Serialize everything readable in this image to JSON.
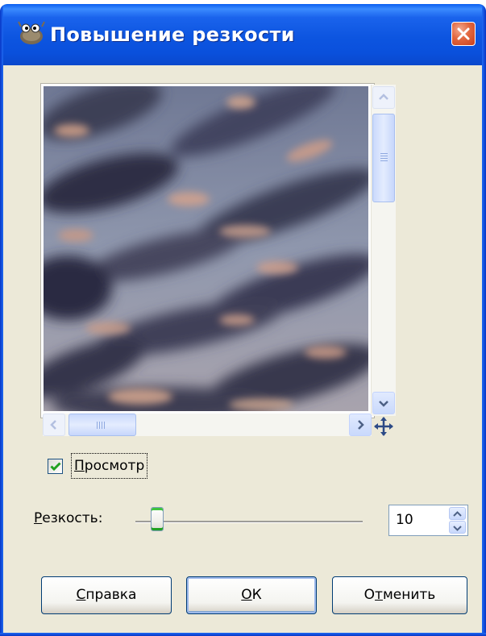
{
  "window": {
    "title": "Повышение резкости",
    "close_label": "Close"
  },
  "preview": {
    "checkbox_checked": true,
    "checkbox_label_mnemonic": "П",
    "checkbox_label_rest": "росмотр"
  },
  "sharpness": {
    "label_mnemonic": "Р",
    "label_rest": "езкость:",
    "value": "10",
    "slider_position_percent": 10
  },
  "buttons": {
    "help_mnemonic": "С",
    "help_rest": "правка",
    "ok_mnemonic": "О",
    "ok_rest": "К",
    "cancel_pre": "О",
    "cancel_mnemonic": "т",
    "cancel_rest": "менить"
  },
  "icons": {
    "app": "gimp-wilber-icon",
    "close": "close-icon",
    "scroll_up": "arrow-up-icon",
    "scroll_down": "arrow-down-icon",
    "scroll_left": "arrow-left-icon",
    "scroll_right": "arrow-right-icon",
    "navigate": "move-navigate-icon",
    "check": "checkmark-icon"
  },
  "colors": {
    "titlebar": "#0a55e0",
    "dialog_bg": "#ece9d8",
    "close_button": "#d9562f",
    "check": "#21a121"
  }
}
